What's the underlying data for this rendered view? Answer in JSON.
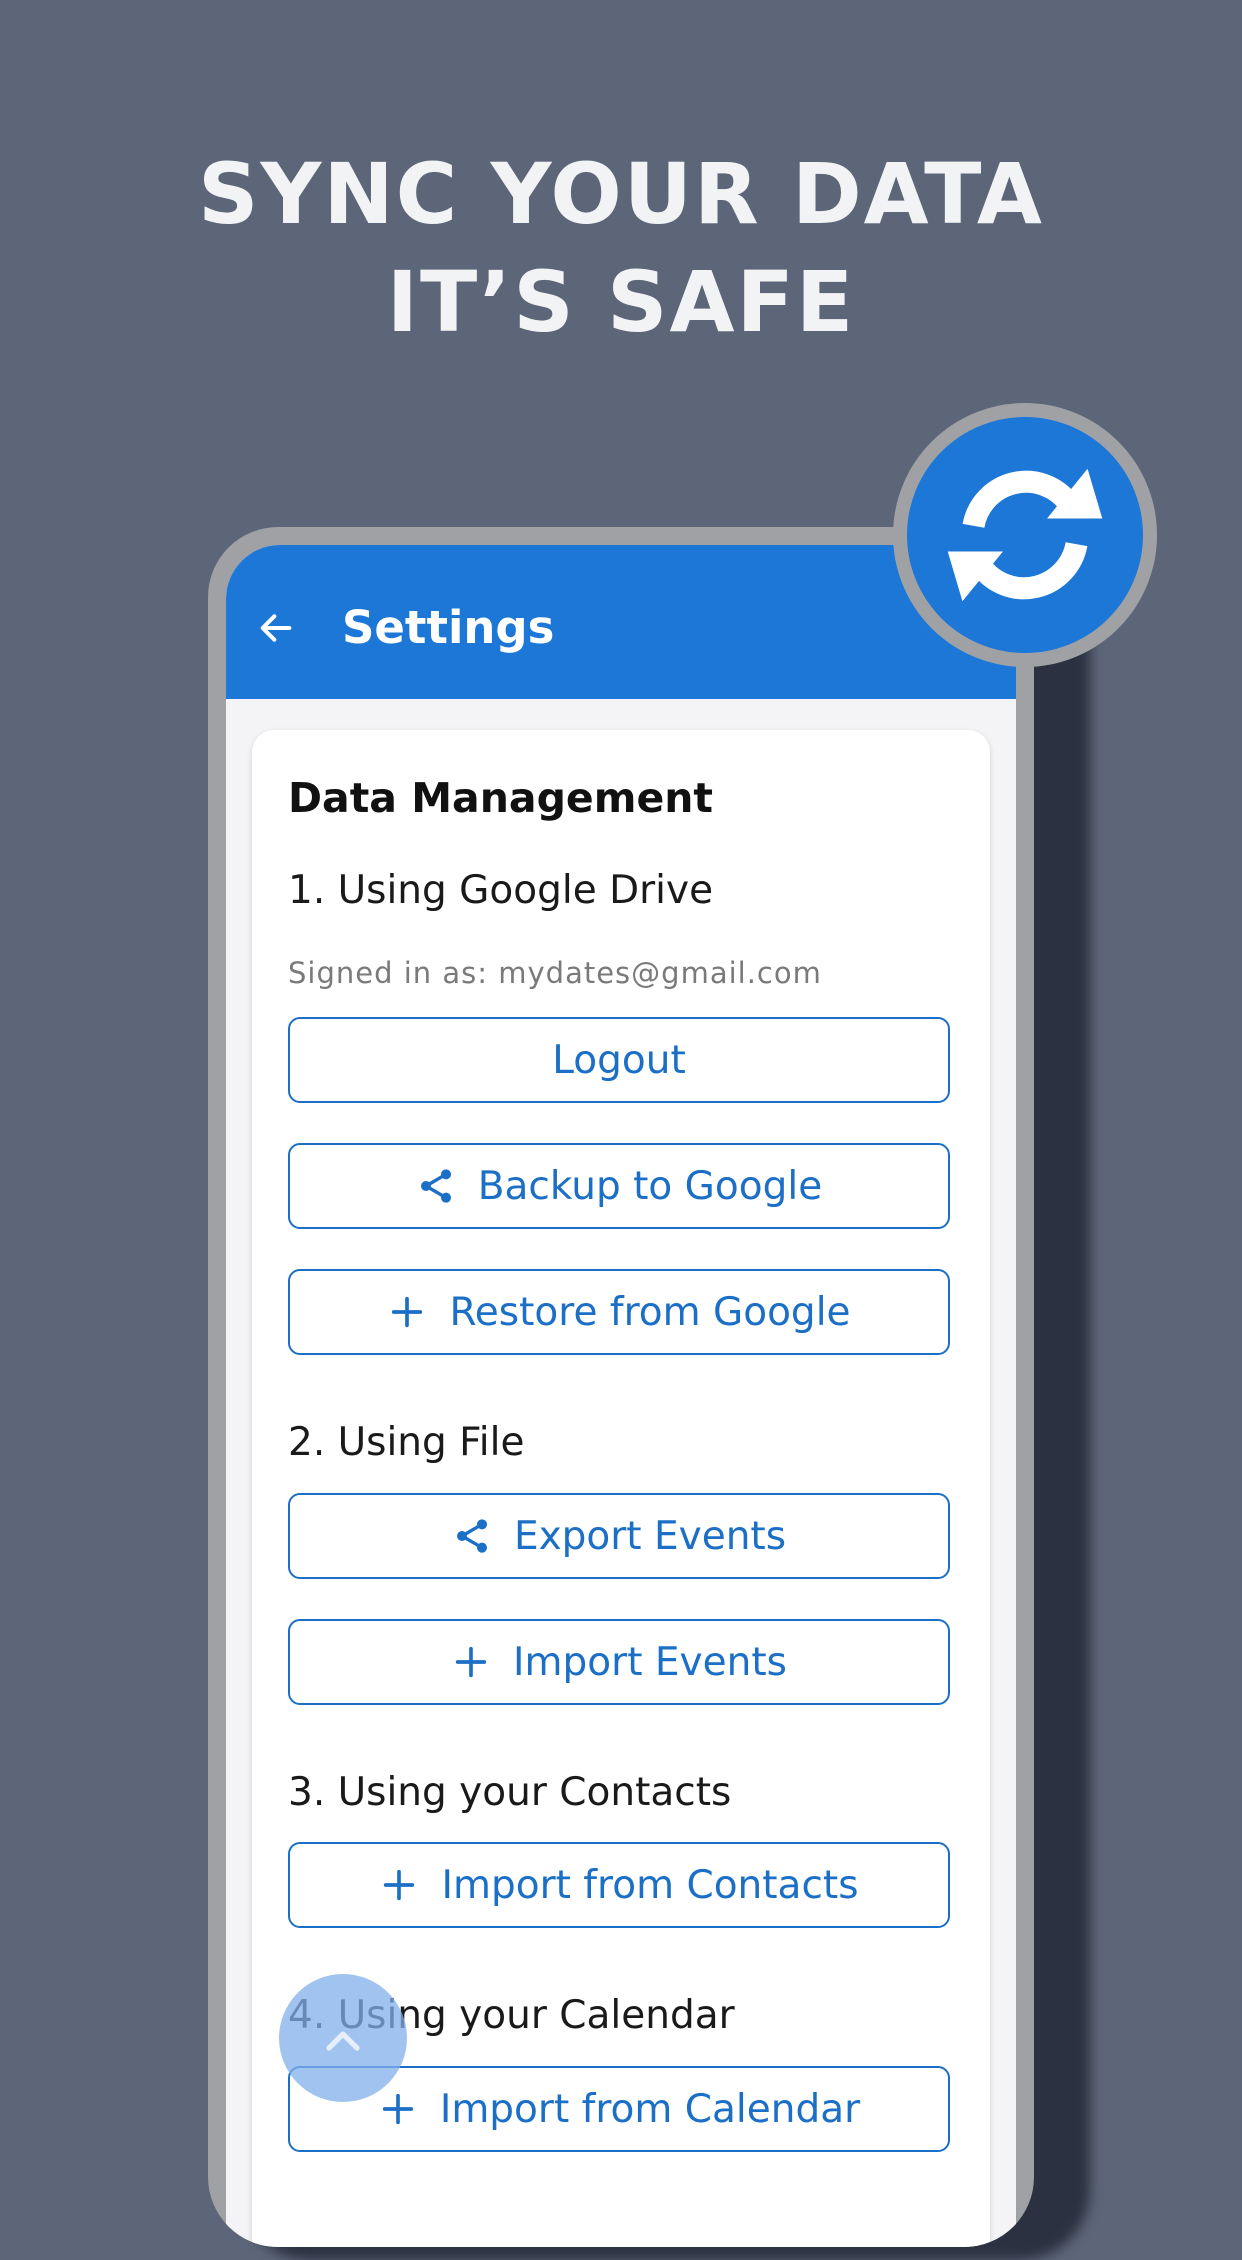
{
  "headline": {
    "line1": "SYNC YOUR DATA",
    "line2": "IT’S SAFE"
  },
  "appbar": {
    "title": "Settings"
  },
  "card": {
    "title": "Data Management",
    "google_section": "1. Using Google Drive",
    "signed_in": "Signed in as: mydates@gmail.com",
    "logout_label": "Logout",
    "backup_label": "Backup to Google",
    "restore_label": "Restore from Google",
    "file_section": "2. Using File",
    "export_label": "Export Events",
    "import_label": "Import Events",
    "contacts_section": "3. Using your Contacts",
    "contacts_label": "Import from Contacts",
    "calendar_section": "4. Using your Calendar",
    "calendar_label": "Import from Calendar"
  },
  "icons": {
    "back": "arrow-left-icon",
    "share": "share-icon",
    "plus": "plus-icon",
    "sync": "sync-icon",
    "up": "chevron-up-icon"
  },
  "colors": {
    "background": "#5c6678",
    "accent": "#1c77d6",
    "button_text": "#1c6fc6",
    "frame": "#9fa1a4"
  }
}
